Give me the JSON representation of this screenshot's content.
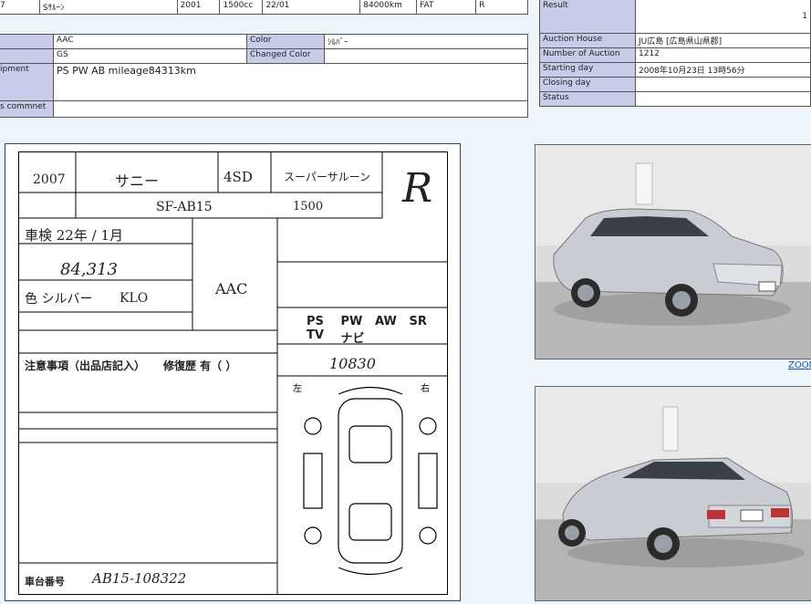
{
  "summary_row": {
    "cells": [
      "7",
      "Sｻﾙｰﾝ",
      "2001",
      "1500cc",
      "22/01",
      "84000km",
      "FAT",
      "R"
    ]
  },
  "details": {
    "grade_label": "",
    "grade_value": "AAC",
    "color_label": "Color",
    "color_value": "ｼﾙﾊﾞｰ",
    "model_label": "",
    "model_value": "GS",
    "changed_color_label": "Changed Color",
    "changed_color_value": "",
    "equipment_label": "ipment",
    "equipment_value": "PS PW AB mileage84313km",
    "comment_label": "s commnet",
    "comment_value": ""
  },
  "auction": {
    "result_label": "Result",
    "result_value": "1",
    "house_label": "Auction House",
    "house_value": "JU広島 [広島県山県郡]",
    "number_label": "Number of Auction",
    "number_value": "1212",
    "start_label": "Starting day",
    "start_value": "2008年10月23日 13時56分",
    "closing_label": "Closing day",
    "closing_value": "",
    "status_label": "Status",
    "status_value": ""
  },
  "sheet": {
    "year": "2007",
    "model": "サニー",
    "doors": "4SD",
    "grade": "スーパーサルーン",
    "score": "R",
    "chassis": "SF-AB15",
    "cc": "1500",
    "inspect": "車検 22年 / 1月",
    "mileage": "84,313",
    "color": "色 シルバー",
    "color_code": "KLO",
    "aac": "AAC",
    "features": [
      "PS",
      "PW",
      "AW",
      "SR",
      "TV",
      "ナビ"
    ],
    "notes_title": "注意事項（出品店記入）",
    "repair": "修復歴 有（ ）",
    "serial_label": "車台番号",
    "serial": "AB15-108322",
    "price": "10830"
  },
  "zoom_label": "ZOOM"
}
